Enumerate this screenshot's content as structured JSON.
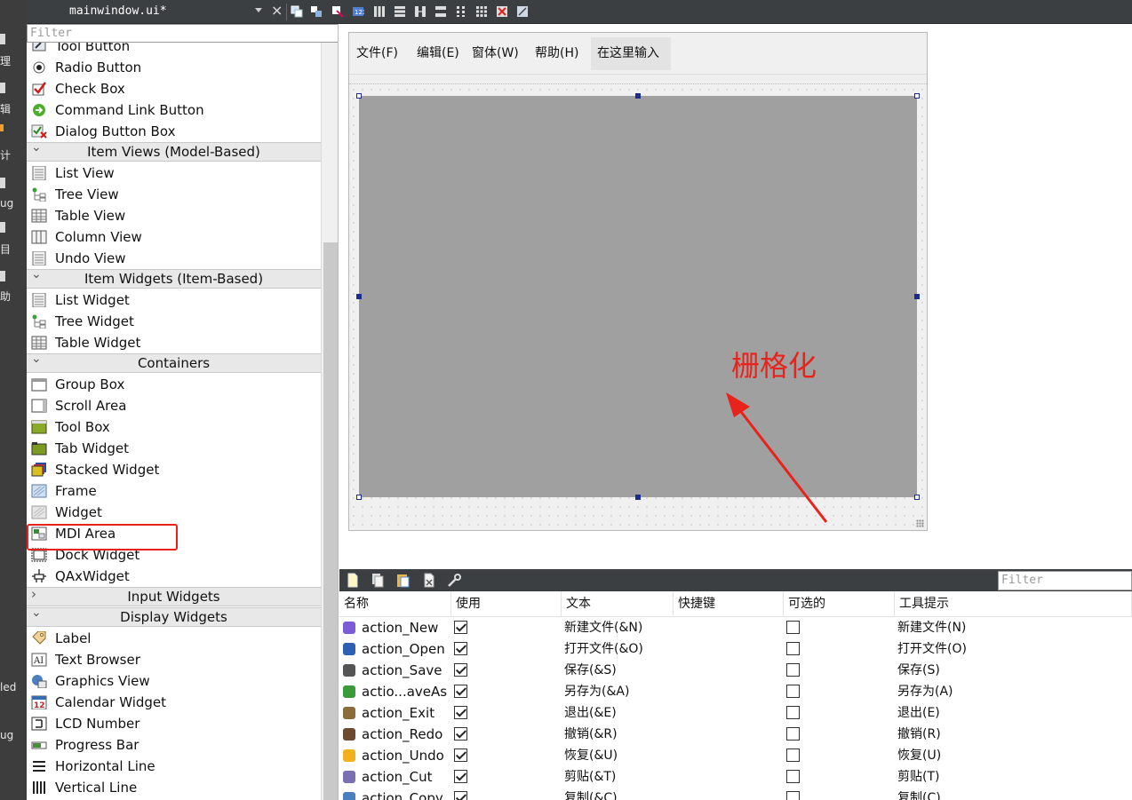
{
  "mode_bar": {
    "items": [
      {
        "label": "理",
        "icon": "welcome-icon"
      },
      {
        "label": "辑",
        "icon": "edit-icon"
      },
      {
        "label": "计",
        "icon": "design-icon"
      },
      {
        "label": "ug",
        "icon": "debug-icon"
      },
      {
        "label": "目",
        "icon": "projects-icon"
      },
      {
        "label": "助",
        "icon": "help-icon"
      },
      {
        "label": "led",
        "icon": "build-target-icon"
      },
      {
        "label": "ug",
        "icon": "run-debug-icon"
      }
    ]
  },
  "document": {
    "title": "mainwindow.ui*"
  },
  "widget_box": {
    "filter_placeholder": "Filter",
    "entries": [
      {
        "kind": "item",
        "label": "Tool Button",
        "icon": "tool-button-icon"
      },
      {
        "kind": "item",
        "label": "Radio Button",
        "icon": "radio-button-icon"
      },
      {
        "kind": "item",
        "label": "Check Box",
        "icon": "check-box-icon"
      },
      {
        "kind": "item",
        "label": "Command Link Button",
        "icon": "command-link-icon"
      },
      {
        "kind": "item",
        "label": "Dialog Button Box",
        "icon": "dialog-button-box-icon"
      },
      {
        "kind": "category",
        "label": "Item Views (Model-Based)",
        "expanded": true
      },
      {
        "kind": "item",
        "label": "List View",
        "icon": "list-view-icon"
      },
      {
        "kind": "item",
        "label": "Tree View",
        "icon": "tree-view-icon"
      },
      {
        "kind": "item",
        "label": "Table View",
        "icon": "table-view-icon"
      },
      {
        "kind": "item",
        "label": "Column View",
        "icon": "column-view-icon"
      },
      {
        "kind": "item",
        "label": "Undo View",
        "icon": "undo-view-icon"
      },
      {
        "kind": "category",
        "label": "Item Widgets (Item-Based)",
        "expanded": true
      },
      {
        "kind": "item",
        "label": "List Widget",
        "icon": "list-widget-icon"
      },
      {
        "kind": "item",
        "label": "Tree Widget",
        "icon": "tree-widget-icon"
      },
      {
        "kind": "item",
        "label": "Table Widget",
        "icon": "table-widget-icon"
      },
      {
        "kind": "category",
        "label": "Containers",
        "expanded": true
      },
      {
        "kind": "item",
        "label": "Group Box",
        "icon": "group-box-icon"
      },
      {
        "kind": "item",
        "label": "Scroll Area",
        "icon": "scroll-area-icon"
      },
      {
        "kind": "item",
        "label": "Tool Box",
        "icon": "tool-box-icon"
      },
      {
        "kind": "item",
        "label": "Tab Widget",
        "icon": "tab-widget-icon"
      },
      {
        "kind": "item",
        "label": "Stacked Widget",
        "icon": "stacked-widget-icon"
      },
      {
        "kind": "item",
        "label": "Frame",
        "icon": "frame-icon"
      },
      {
        "kind": "item",
        "label": "Widget",
        "icon": "widget-icon"
      },
      {
        "kind": "item",
        "label": "MDI Area",
        "icon": "mdi-area-icon",
        "highlighted": true
      },
      {
        "kind": "item",
        "label": "Dock Widget",
        "icon": "dock-widget-icon"
      },
      {
        "kind": "item",
        "label": "QAxWidget",
        "icon": "qax-widget-icon"
      },
      {
        "kind": "category",
        "label": "Input Widgets",
        "expanded": false
      },
      {
        "kind": "category",
        "label": "Display Widgets",
        "expanded": true
      },
      {
        "kind": "item",
        "label": "Label",
        "icon": "label-icon"
      },
      {
        "kind": "item",
        "label": "Text Browser",
        "icon": "text-browser-icon"
      },
      {
        "kind": "item",
        "label": "Graphics View",
        "icon": "graphics-view-icon"
      },
      {
        "kind": "item",
        "label": "Calendar Widget",
        "icon": "calendar-widget-icon"
      },
      {
        "kind": "item",
        "label": "LCD Number",
        "icon": "lcd-number-icon"
      },
      {
        "kind": "item",
        "label": "Progress Bar",
        "icon": "progress-bar-icon"
      },
      {
        "kind": "item",
        "label": "Horizontal Line",
        "icon": "horizontal-line-icon"
      },
      {
        "kind": "item",
        "label": "Vertical Line",
        "icon": "vertical-line-icon"
      }
    ]
  },
  "form": {
    "menus": [
      "文件(F)",
      "编辑(E)",
      "窗体(W)",
      "帮助(H)",
      "在这里输入"
    ],
    "central_widget": "MDI Area"
  },
  "annotation": {
    "text": "栅格化",
    "color": "#e8231c"
  },
  "action_editor": {
    "filter_placeholder": "Filter",
    "columns": [
      "名称",
      "使用",
      "文本",
      "快捷键",
      "可选的",
      "工具提示"
    ],
    "rows": [
      {
        "name": "action_New",
        "used": true,
        "text": "新建文件(&N)",
        "shortcut": "",
        "checkable": false,
        "tooltip": "新建文件(N)",
        "icon": "new-file-icon",
        "icon_color": "#7b5bd6"
      },
      {
        "name": "action_Open",
        "used": true,
        "text": "打开文件(&O)",
        "shortcut": "",
        "checkable": false,
        "tooltip": "打开文件(O)",
        "icon": "open-file-icon",
        "icon_color": "#2f5fb3"
      },
      {
        "name": "action_Save",
        "used": true,
        "text": "保存(&S)",
        "shortcut": "",
        "checkable": false,
        "tooltip": "保存(S)",
        "icon": "save-icon",
        "icon_color": "#555555"
      },
      {
        "name": "actio...aveAs",
        "used": true,
        "text": "另存为(&A)",
        "shortcut": "",
        "checkable": false,
        "tooltip": "另存为(A)",
        "icon": "save-as-icon",
        "icon_color": "#3a9a3a"
      },
      {
        "name": "action_Exit",
        "used": true,
        "text": "退出(&E)",
        "shortcut": "",
        "checkable": false,
        "tooltip": "退出(E)",
        "icon": "exit-icon",
        "icon_color": "#8a6d3b"
      },
      {
        "name": "action_Redo",
        "used": true,
        "text": "撤销(&R)",
        "shortcut": "",
        "checkable": false,
        "tooltip": "撤销(R)",
        "icon": "redo-icon",
        "icon_color": "#6b4a2f"
      },
      {
        "name": "action_Undo",
        "used": true,
        "text": "恢复(&U)",
        "shortcut": "",
        "checkable": false,
        "tooltip": "恢复(U)",
        "icon": "undo-icon",
        "icon_color": "#f2b01e"
      },
      {
        "name": "action_Cut",
        "used": true,
        "text": "剪贴(&T)",
        "shortcut": "",
        "checkable": false,
        "tooltip": "剪贴(T)",
        "icon": "cut-icon",
        "icon_color": "#7a6fb0"
      },
      {
        "name": "action_Copy",
        "used": true,
        "text": "复制(&C)",
        "shortcut": "",
        "checkable": false,
        "tooltip": "复制(C)",
        "icon": "copy-icon",
        "icon_color": "#4a7fc0"
      }
    ]
  }
}
